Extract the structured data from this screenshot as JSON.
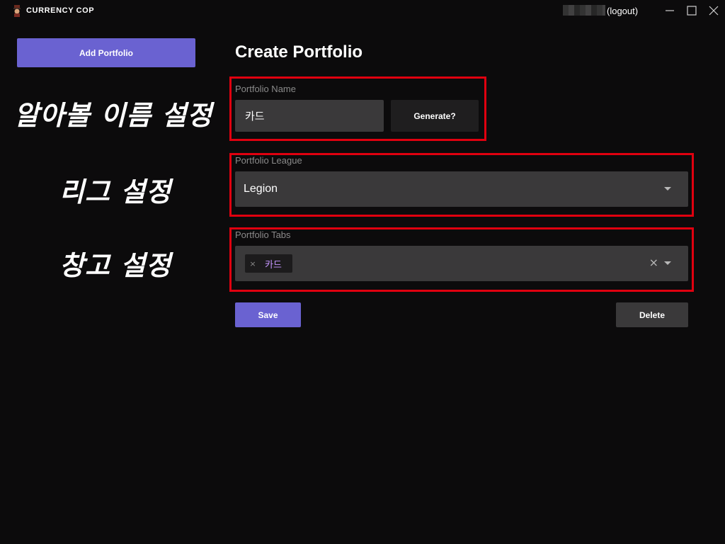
{
  "app": {
    "title": "CURRENCY COP",
    "logout_label": "(logout)"
  },
  "sidebar": {
    "add_portfolio_label": "Add Portfolio"
  },
  "annotations": {
    "name_note": "알아볼 이름 설정",
    "league_note": "리그 설정",
    "tabs_note": "창고 설정"
  },
  "main": {
    "title": "Create Portfolio",
    "portfolio_name": {
      "label": "Portfolio Name",
      "value": "카드",
      "generate_label": "Generate?"
    },
    "portfolio_league": {
      "label": "Portfolio League",
      "selected": "Legion"
    },
    "portfolio_tabs": {
      "label": "Portfolio Tabs",
      "selected_tabs": [
        "카드"
      ],
      "chip_remove_symbol": "×",
      "clear_symbol": "×"
    },
    "save_label": "Save",
    "delete_label": "Delete"
  },
  "colors": {
    "accent": "#6a62d1",
    "background": "#0c0b0c",
    "field_bg": "#3a393a",
    "highlight_box": "#e0000f",
    "chip_text": "#c596ff"
  },
  "icons": {
    "logo": "currency-cop-logo-icon",
    "minimize": "minimize-icon",
    "maximize": "maximize-icon",
    "close": "close-icon",
    "dropdown": "chevron-down-icon"
  }
}
